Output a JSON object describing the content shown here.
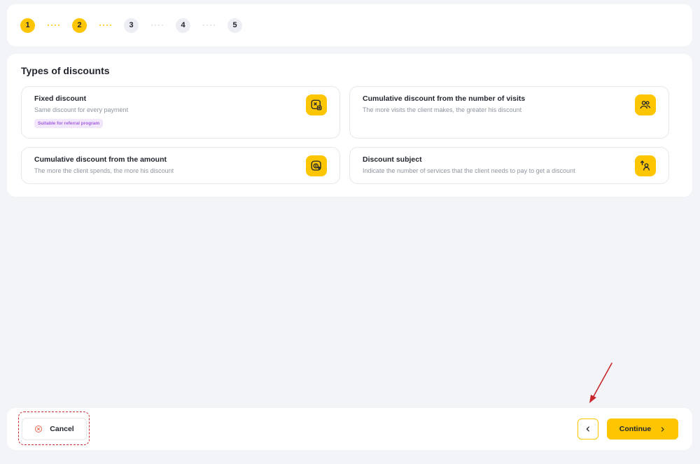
{
  "stepper": {
    "steps": [
      {
        "label": "1",
        "state": "active"
      },
      {
        "label": "2",
        "state": "active"
      },
      {
        "label": "3",
        "state": "inactive"
      },
      {
        "label": "4",
        "state": "inactive"
      },
      {
        "label": "5",
        "state": "inactive"
      }
    ]
  },
  "discounts": {
    "title": "Types of discounts",
    "cards": [
      {
        "title": "Fixed discount",
        "description": "Same discount for every payment",
        "badge": "Suitable for referral program",
        "icon": "percent-tag-icon"
      },
      {
        "title": "Cumulative discount from the number of visits",
        "description": "The more visits the client makes, the greater his discount",
        "icon": "users-icon"
      },
      {
        "title": "Cumulative discount from the amount",
        "description": "The more the client spends, the more his discount",
        "icon": "coin-growth-icon"
      },
      {
        "title": "Discount subject",
        "description": "Indicate the number of services that the client needs to pay to get a discount",
        "icon": "user-upgrade-icon"
      }
    ]
  },
  "footer": {
    "cancel_label": "Cancel",
    "continue_label": "Continue"
  },
  "colors": {
    "accent": "#fdc600",
    "background": "#f2f4f8",
    "badge_bg": "#f1e6fb",
    "badge_text": "#a45ee0",
    "annotation": "#c7282b"
  }
}
